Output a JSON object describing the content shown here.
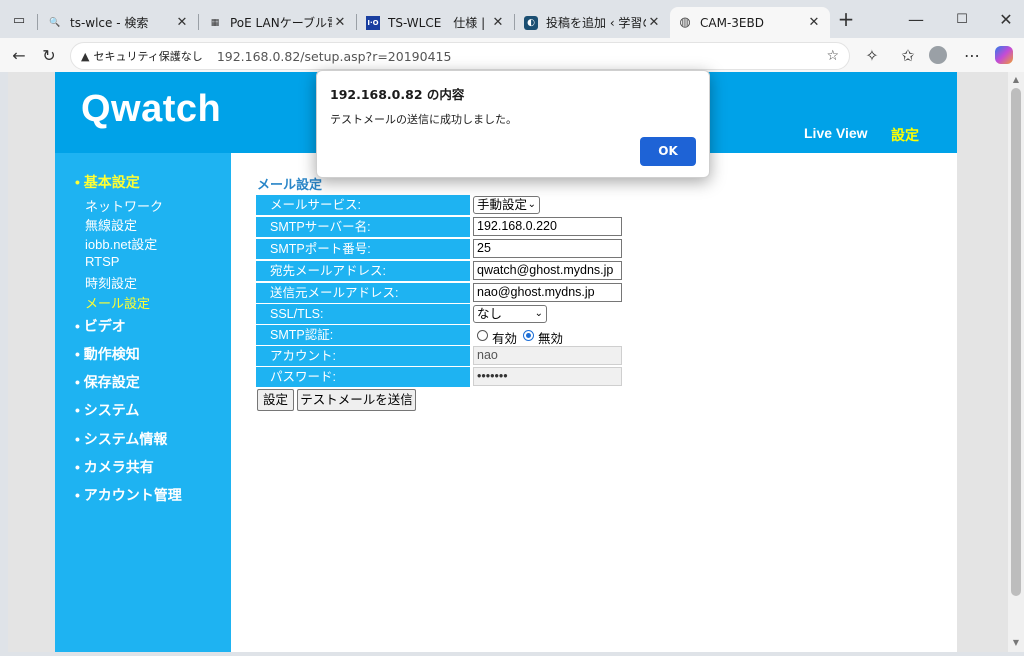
{
  "browser": {
    "tabs": [
      {
        "title": "ts-wlce - 検索",
        "favicon": "search-icon"
      },
      {
        "title": "PoE LANケーブル電源供",
        "favicon": "chip-icon"
      },
      {
        "title": "TS-WLCE　仕様 | ネット",
        "favicon": "iodata-icon"
      },
      {
        "title": "投稿を追加 ‹ 学習の補助",
        "favicon": "wordpress-icon"
      },
      {
        "title": "CAM-3EBD",
        "favicon": "globe-icon"
      }
    ],
    "security_label": "セキュリティ保護なし",
    "url": "192.168.0.82/setup.asp?r=20190415"
  },
  "page": {
    "logo": "Qwatch",
    "nav": {
      "live_view": "Live View",
      "settings": "設定"
    },
    "sidebar": {
      "sections": [
        {
          "label": "• 基本設定",
          "active": true,
          "items": [
            "ネットワーク",
            "無線設定",
            "iobb.net設定",
            "RTSP",
            "時刻設定",
            "メール設定"
          ],
          "active_item": "メール設定"
        },
        {
          "label": "• ビデオ"
        },
        {
          "label": "• 動作検知"
        },
        {
          "label": "• 保存設定"
        },
        {
          "label": "• システム"
        },
        {
          "label": "• システム情報"
        },
        {
          "label": "• カメラ共有"
        },
        {
          "label": "• アカウント管理"
        }
      ]
    },
    "form": {
      "title": "メール設定",
      "rows": [
        {
          "label": "メールサービス:",
          "type": "select",
          "value": "手動設定"
        },
        {
          "label": "SMTPサーバー名:",
          "type": "text",
          "value": "192.168.0.220"
        },
        {
          "label": "SMTPポート番号:",
          "type": "text",
          "value": "25"
        },
        {
          "label": "宛先メールアドレス:",
          "type": "text",
          "value": "qwatch@ghost.mydns.jp"
        },
        {
          "label": "送信元メールアドレス:",
          "type": "text",
          "value": "nao@ghost.mydns.jp"
        },
        {
          "label": "SSL/TLS:",
          "type": "select",
          "value": "なし"
        },
        {
          "label": "SMTP認証:",
          "type": "radio",
          "options": [
            "有効",
            "無効"
          ],
          "selected": "無効"
        },
        {
          "label": "アカウント:",
          "type": "text-disabled",
          "value": "nao"
        },
        {
          "label": "パスワード:",
          "type": "password-disabled",
          "value": "•••••••"
        }
      ],
      "buttons": {
        "save": "設定",
        "test": "テストメールを送信"
      }
    }
  },
  "dialog": {
    "title": "192.168.0.82 の内容",
    "message": "テストメールの送信に成功しました。",
    "ok": "OK"
  },
  "colors": {
    "header": "#00a2e8",
    "sidebar": "#1eb3f2",
    "accent_yellow": "#ffff00",
    "dialog_button": "#1e63d6"
  }
}
